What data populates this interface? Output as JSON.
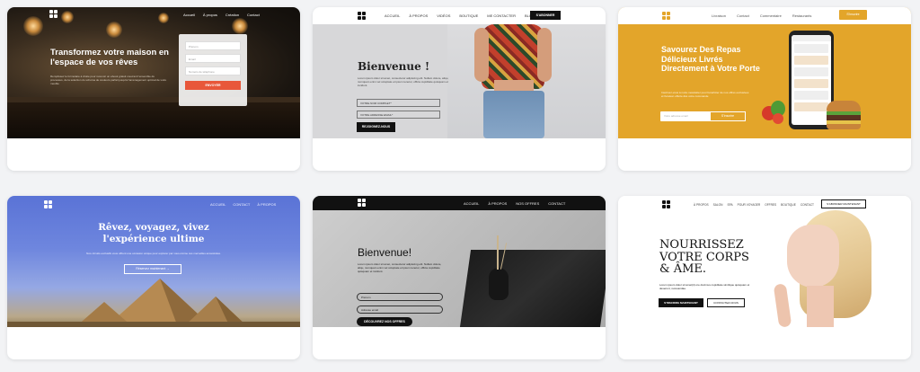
{
  "colors": {
    "accent_red": "#e8573a",
    "mustard": "#e3a52a",
    "black": "#111111",
    "white": "#ffffff"
  },
  "templates": [
    {
      "nav": [
        "Accueil",
        "À propos",
        "Création",
        "Contact"
      ],
      "headline": "Transformez votre maison en l'espace de vos rêves",
      "body": "Remplissez le formulaire à droite pour recevoir un ebook gratuit couvrant l'ensemble du processus, de la sélection du schéma de couleurs parfait jusqu'à l'aménagement optimal de votre meuble",
      "form_placeholders": [
        "Prénom",
        "Email",
        "Numéro de téléphone"
      ],
      "form_button": "ENVOYER"
    },
    {
      "nav": [
        "ACCUEIL",
        "À PROPOS",
        "VIDÉOS",
        "BOUTIQUE",
        "ME CONTACTER",
        "BLOG"
      ],
      "nav_button": "S'ABONNER",
      "headline": "Bienvenue !",
      "body": "Lorem ipsum dolor sit amet, consectetur adipiscing elit. Nullam dolore, aliqu, numquam enim vel voluptate et ipsum tenetur, officia cupiditate quisquam et incidunt.",
      "inputs": [
        "VOTRE NOM COMPLET*",
        "VOTRE ADRESSE EMAIL*"
      ],
      "button": "REJOIGNEZ-NOUS"
    },
    {
      "nav": [
        "Livraison",
        "Contact",
        "Commentaire",
        "Restaurants"
      ],
      "nav_button": "S'inscrire",
      "headline": "Savourez Des Repas Délicieux Livrés Directement à Votre Porte",
      "body": "Inscrivez-vous à notre newsletter pour bénéficier de nos offres exclusives et livraison offerte dès votre commande",
      "input_placeholder": "Votre adresse email",
      "button": "S'inscrire"
    },
    {
      "nav": [
        "ACCUEIL",
        "CONTACT",
        "À PROPOS"
      ],
      "headline": "Rêvez, voyagez, vivez l'expérience ultime",
      "body": "Nos circuits exclusifs vous offrent une occasion unique pour explorer par vous-même ces merveilles ancestrales.",
      "button": "Réservez maintenant"
    },
    {
      "nav": [
        "ACCUEIL",
        "À PROPOS",
        "NOS OFFRES",
        "CONTACT"
      ],
      "headline": "Bienvenue!",
      "body": "Lorem ipsum dolor sit amet, consectetur adipiscing elit. Nullam dolore, aliqu, numquam enim vel voluptate et ipsum tenetur, officia cupiditate quisquam et incidunt.",
      "inputs": [
        "Prénom",
        "Adresse email"
      ],
      "button": "DÉCOUVREZ NOS OFFRES"
    },
    {
      "nav": [
        "À PROPOS",
        "SALON",
        "SPA",
        "POUR VOYAGER",
        "OFFRES",
        "BOUTIQUE",
        "CONTACT"
      ],
      "nav_button": "S'ABONNER MAINTENANT",
      "headline_lines": [
        "NOURRISSEZ",
        "VOTRE CORPS",
        "& ÂME."
      ],
      "body": "Lorem ipsum dolor sit amet(it) ore ducimus cupiditate similique quisquam et deserunt, recusandae.",
      "button_primary": "S'INSCRIRE MAINTENANT",
      "button_secondary": "CONTACTEZ-NOUS"
    }
  ]
}
